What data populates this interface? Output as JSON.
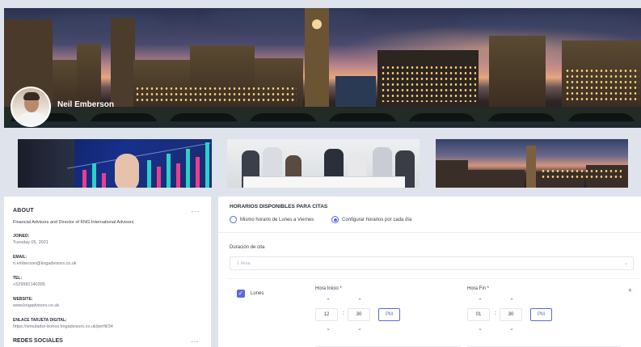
{
  "profile": {
    "name": "Neil Emberson"
  },
  "about": {
    "title": "ABOUT",
    "more": "...",
    "description": "Financial Advisors and Director of KNG International Advisors",
    "fields": [
      {
        "label": "JOINED:",
        "value": "Tuesday 05, 2021"
      },
      {
        "label": "EMAIL:",
        "value": "n.emberson@kngadvisors.co.uk"
      },
      {
        "label": "TEL:",
        "value": "+529982140395"
      },
      {
        "label": "WEBSITE:",
        "value": "www.kngadvisors.co.uk"
      },
      {
        "label": "ENLACE TARJETA DIGITAL:",
        "value": "https://simulador-bonos.kngadvisors.co.uk/perfil/34"
      }
    ],
    "social_title": "REDES SOCIALES",
    "social_more": "..."
  },
  "schedule": {
    "title": "HORARIOS DISPONIBLES PARA CITAS",
    "options": [
      {
        "label": "Mismo horario de Lunes a Viernes",
        "selected": false
      },
      {
        "label": "Configurar horarios por cada día",
        "selected": true
      }
    ],
    "duration_label": "Duración de cita",
    "duration_value": "1 Hora",
    "day": {
      "label": "Lunes",
      "checked": true
    },
    "start": {
      "label": "Hora Inicio *",
      "hour": "12",
      "minute": "30",
      "period": "PM"
    },
    "end": {
      "label": "Hora Fin *",
      "hour": "01",
      "minute": "30",
      "period": "PM"
    },
    "add": "+",
    "colon": ":"
  },
  "colors": {
    "accent": "#5b6ad8",
    "background": "#dfe3ec"
  }
}
